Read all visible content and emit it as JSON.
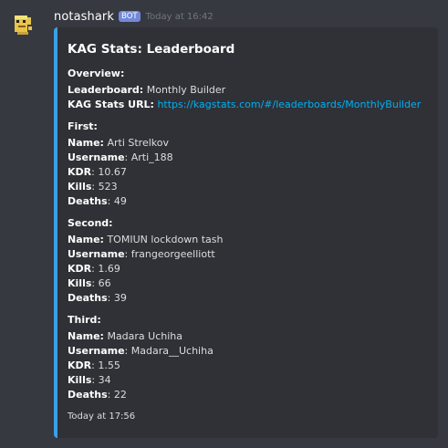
{
  "message": {
    "author": "notashark",
    "bot_tag": "BOT",
    "timestamp": "Today at 16:42"
  },
  "embed": {
    "accent_color": "#3aa0e8",
    "title": "KAG Stats: Leaderboard",
    "overview": {
      "heading": "Overview:",
      "leaderboard_label": "Leaderboard:",
      "leaderboard_value": "Monthly Builder",
      "url_label": "KAG Stats URL:",
      "url_value": "https://kagstats.com/#/leaderboards/MonthlyBuilder"
    },
    "sections": [
      {
        "heading": "First:",
        "name_label": "Name:",
        "name": "Arti Strelkov",
        "username_label": "Username",
        "username": "Arti_188",
        "kdr_label": "KDR",
        "kdr": "10.67",
        "kills_label": "Kills",
        "kills": "523",
        "deaths_label": "Deaths",
        "deaths": "49"
      },
      {
        "heading": "Second:",
        "name_label": "Name:",
        "name": "TOMIUN lockdown tash",
        "username_label": "Username",
        "username": "frangeorgeelliott",
        "kdr_label": "KDR",
        "kdr": "1.69",
        "kills_label": "Kills",
        "kills": "66",
        "deaths_label": "Deaths",
        "deaths": "39"
      },
      {
        "heading": "Third:",
        "name_label": "Name:",
        "name": "Madara Uchiha",
        "username_label": "Username",
        "username": "Madara__Uchiha",
        "kdr_label": "KDR",
        "kdr": "1.55",
        "kills_label": "Kills",
        "kills": "34",
        "deaths_label": "Deaths",
        "deaths": "22"
      }
    ],
    "footer": "Today at 17:56"
  }
}
